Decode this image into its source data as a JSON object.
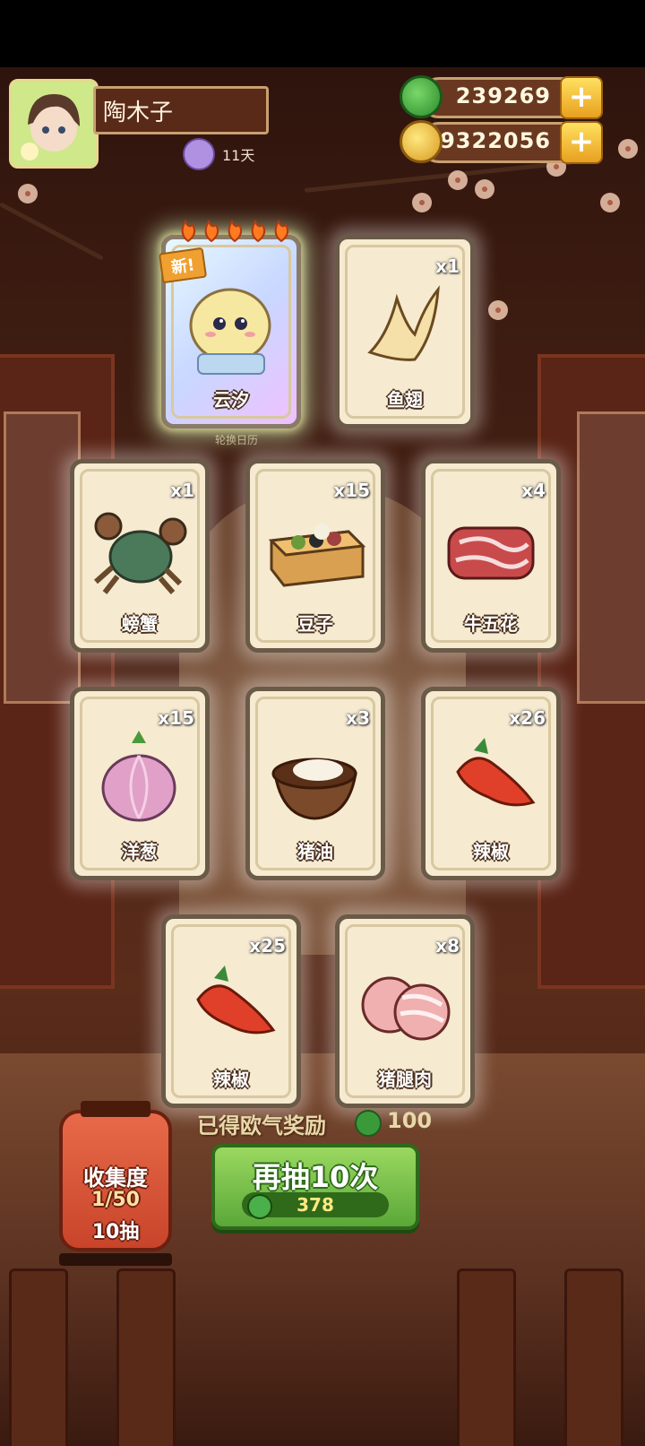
{
  "player": {
    "name": "陶木子",
    "streak": "11天"
  },
  "currency": {
    "jade": "239269",
    "coins": "89322056",
    "add_symbol": "+"
  },
  "background": {
    "calendar_label": "轮换日历"
  },
  "cards": [
    {
      "name": "云汐",
      "count": "",
      "tag": "新!",
      "icon": "character-portrait",
      "special": true
    },
    {
      "name": "鱼翅",
      "count": "x1",
      "icon": "shark-fin-icon"
    },
    {
      "name": "螃蟹",
      "count": "x1",
      "icon": "crab-icon"
    },
    {
      "name": "豆子",
      "count": "x15",
      "icon": "beans-box-icon"
    },
    {
      "name": "牛五花",
      "count": "x4",
      "icon": "beef-belly-icon"
    },
    {
      "name": "洋葱",
      "count": "x15",
      "icon": "onion-icon"
    },
    {
      "name": "猪油",
      "count": "x3",
      "icon": "lard-bowl-icon"
    },
    {
      "name": "辣椒",
      "count": "x26",
      "icon": "chili-pepper-icon"
    },
    {
      "name": "辣椒",
      "count": "x25",
      "icon": "chili-pepper-icon"
    },
    {
      "name": "猪腿肉",
      "count": "x8",
      "icon": "pork-leg-icon"
    }
  ],
  "reward": {
    "label": "已得欧气奖励",
    "value": "100"
  },
  "draw_button": {
    "label": "再抽10次",
    "cost": "378"
  },
  "collection": {
    "label": "收集度",
    "progress": "1/50",
    "draws": "10抽"
  },
  "colors": {
    "accent_green": "#5aa838",
    "card_bg": "#f6ead0",
    "coin_gold": "#e8a020"
  }
}
